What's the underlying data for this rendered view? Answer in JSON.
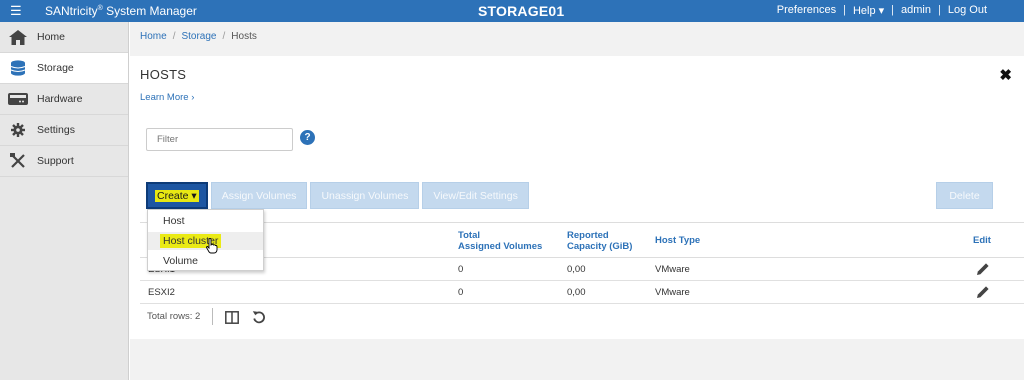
{
  "topbar": {
    "brand": "SANtricity",
    "brand_reg": "®",
    "brand_suffix": " System Manager",
    "title": "STORAGE01",
    "links": [
      "Preferences",
      "Help ▾",
      "admin",
      "Log Out"
    ]
  },
  "sidebar": {
    "items": [
      {
        "label": "Home",
        "icon": "home-icon"
      },
      {
        "label": "Storage",
        "icon": "database-icon"
      },
      {
        "label": "Hardware",
        "icon": "server-icon"
      },
      {
        "label": "Settings",
        "icon": "gear-icon"
      },
      {
        "label": "Support",
        "icon": "tools-icon"
      }
    ]
  },
  "breadcrumb": [
    "Home",
    "Storage",
    "Hosts"
  ],
  "page": {
    "title": "HOSTS",
    "learn_more": "Learn More ›",
    "filter_placeholder": "Filter"
  },
  "toolbar": {
    "create": "Create",
    "assign": "Assign Volumes",
    "unassign": "Unassign Volumes",
    "view_edit": "View/Edit Settings",
    "delete": "Delete"
  },
  "dropdown": [
    "Host",
    "Host cluster",
    "Volume"
  ],
  "table": {
    "headers": {
      "total_line1": "Total",
      "total_line2": "Assigned Volumes",
      "reported_line1": "Reported",
      "reported_line2": "Capacity (GiB)",
      "host_type": "Host Type",
      "edit": "Edit"
    },
    "rows": [
      {
        "name": "ESXI1",
        "volumes": "0",
        "capacity": "0,00",
        "type": "VMware"
      },
      {
        "name": "ESXI2",
        "volumes": "0",
        "capacity": "0,00",
        "type": "VMware"
      }
    ],
    "total_rows": "Total rows: 2"
  },
  "colors": {
    "topbar": "#2d72b8",
    "create_button": "#1d56a2",
    "highlight": "#e8e813"
  }
}
